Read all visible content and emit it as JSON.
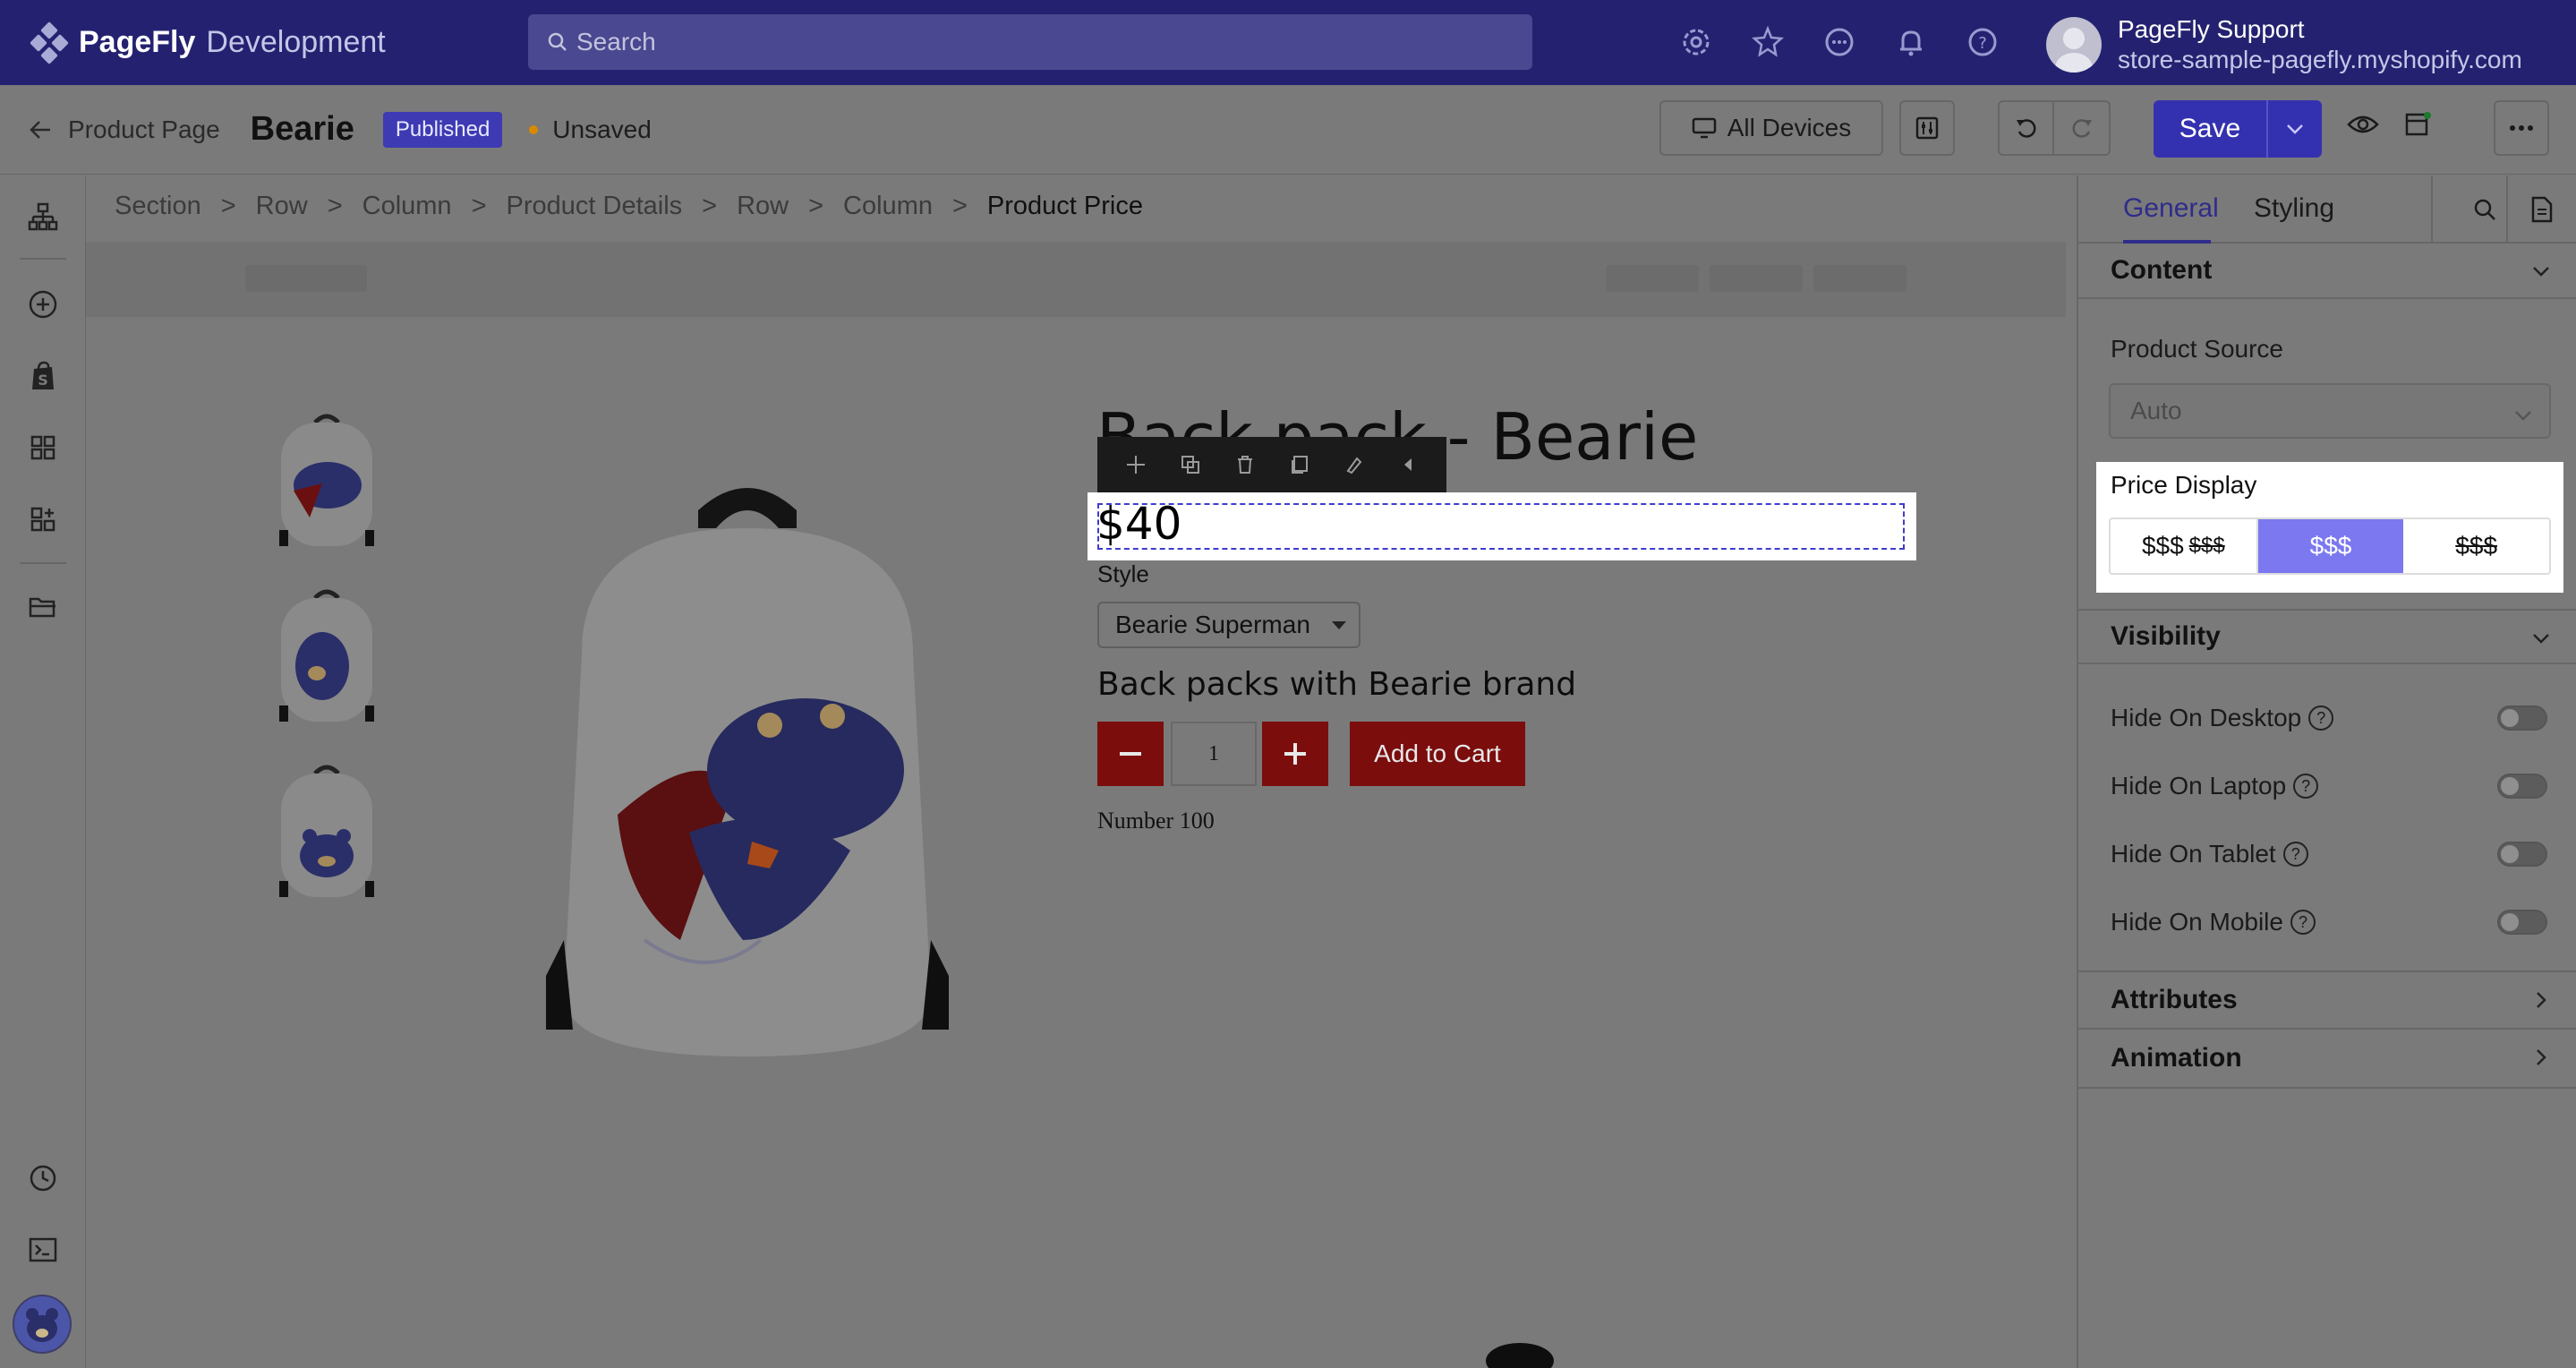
{
  "topbar": {
    "brand": "PageFly",
    "brand_sub": "Development",
    "search_placeholder": "Search",
    "user_name": "PageFly Support",
    "user_store": "store-sample-pagefly.myshopify.com"
  },
  "editor_bar": {
    "back_label": "Product Page",
    "page_name": "Bearie",
    "status_badge": "Published",
    "save_state": "Unsaved",
    "devices_label": "All Devices",
    "save_label": "Save"
  },
  "breadcrumb": [
    "Section",
    "Row",
    "Column",
    "Product Details",
    "Row",
    "Column",
    "Product Price"
  ],
  "product": {
    "title": "Back pack - Bearie",
    "price": "$40",
    "style_label": "Style",
    "style_value": "Bearie Superman",
    "description": "Back packs with Bearie brand",
    "quantity": "1",
    "add_to_cart": "Add to Cart",
    "number_text": "Number 100"
  },
  "panel": {
    "tabs": [
      "General",
      "Styling"
    ],
    "content_heading": "Content",
    "product_source_label": "Product Source",
    "product_source_value": "Auto",
    "price_display_label": "Price Display",
    "price_display_options": [
      "$$$",
      "$$$",
      "$$$",
      "$$$"
    ],
    "visibility_heading": "Visibility",
    "visibility_toggles": [
      "Hide On Desktop",
      "Hide On Laptop",
      "Hide On Tablet",
      "Hide On Mobile"
    ],
    "attributes_heading": "Attributes",
    "animation_heading": "Animation"
  },
  "colors": {
    "topbar_bg": "#242270",
    "accent": "#3431b0",
    "selected_segment": "#7b78f0",
    "cart_red": "#7b0d0d"
  },
  "icons": [
    "pagefly-logo-icon",
    "search-icon",
    "settings-icon",
    "star-icon",
    "chat-icon",
    "bell-icon",
    "help-icon",
    "arrow-left-icon",
    "monitor-icon",
    "sliders-icon",
    "undo-icon",
    "redo-icon",
    "chevron-down-icon",
    "eye-icon",
    "publish-icon",
    "more-icon",
    "layers-icon",
    "add-icon",
    "shopify-icon",
    "grid-icon",
    "apps-icon",
    "folder-icon",
    "history-icon",
    "terminal-icon",
    "move-icon",
    "duplicate-icon",
    "trash-icon",
    "copy-icon",
    "style-icon",
    "collapse-icon",
    "file-icon"
  ]
}
